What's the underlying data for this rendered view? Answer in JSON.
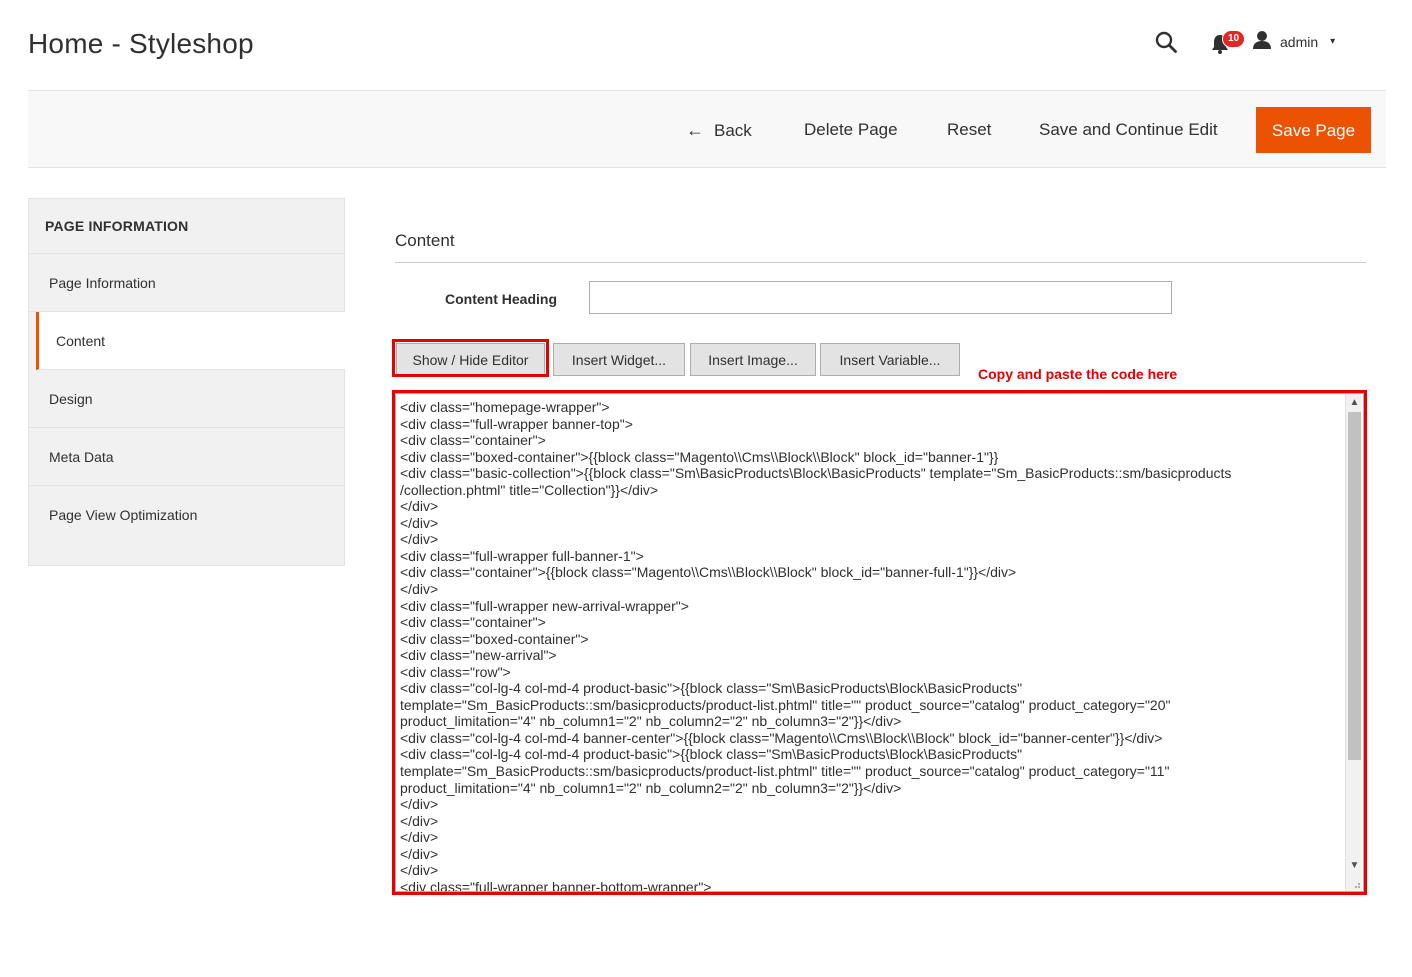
{
  "header": {
    "title": "Home - Styleshop",
    "notification_count": "10",
    "user_name": "admin",
    "user_caret": "▾",
    "icons": [
      "search-icon",
      "bell-icon",
      "user-icon"
    ]
  },
  "toolbar": {
    "back_label": "Back",
    "back_arrow": "←",
    "delete_label": "Delete Page",
    "reset_label": "Reset",
    "save_continue_label": "Save and Continue Edit",
    "save_label": "Save Page",
    "save_color": "#eb5202"
  },
  "sidebar": {
    "heading": "PAGE INFORMATION",
    "items": [
      {
        "label": "Page Information",
        "active": false
      },
      {
        "label": "Content",
        "active": true
      },
      {
        "label": "Design",
        "active": false
      },
      {
        "label": "Meta Data",
        "active": false
      },
      {
        "label": "Page View Optimization",
        "active": false
      }
    ]
  },
  "content": {
    "section_title": "Content",
    "heading_label": "Content Heading",
    "heading_value": "",
    "editor_buttons": {
      "toggle": "Show / Hide Editor",
      "widget": "Insert Widget...",
      "image": "Insert Image...",
      "variable": "Insert Variable..."
    },
    "annotation": "Copy and paste the code here",
    "highlight_color": "#e60000",
    "scroll_up": "▲",
    "scroll_down": "▼",
    "code_lines": [
      "<div class=\"homepage-wrapper\">",
      "<div class=\"full-wrapper banner-top\">",
      "<div class=\"container\">",
      "<div class=\"boxed-container\">{{block class=\"Magento\\\\Cms\\\\Block\\\\Block\" block_id=\"banner-1\"}}",
      "<div class=\"basic-collection\">{{block class=\"Sm\\BasicProducts\\Block\\BasicProducts\" template=\"Sm_BasicProducts::sm/basicproducts",
      "/collection.phtml\" title=\"Collection\"}}</div>",
      "</div>",
      "</div>",
      "</div>",
      "<div class=\"full-wrapper full-banner-1\">",
      "<div class=\"container\">{{block class=\"Magento\\\\Cms\\\\Block\\\\Block\" block_id=\"banner-full-1\"}}</div>",
      "</div>",
      "<div class=\"full-wrapper new-arrival-wrapper\">",
      "<div class=\"container\">",
      "<div class=\"boxed-container\">",
      "<div class=\"new-arrival\">",
      "<div class=\"row\">",
      "<div class=\"col-lg-4 col-md-4 product-basic\">{{block class=\"Sm\\BasicProducts\\Block\\BasicProducts\"",
      "template=\"Sm_BasicProducts::sm/basicproducts/product-list.phtml\" title=\"\" product_source=\"catalog\" product_category=\"20\"",
      "product_limitation=\"4\" nb_column1=\"2\" nb_column2=\"2\" nb_column3=\"2\"}}</div>",
      "<div class=\"col-lg-4 col-md-4 banner-center\">{{block class=\"Magento\\\\Cms\\\\Block\\\\Block\" block_id=\"banner-center\"}}</div>",
      "<div class=\"col-lg-4 col-md-4 product-basic\">{{block class=\"Sm\\BasicProducts\\Block\\BasicProducts\"",
      "template=\"Sm_BasicProducts::sm/basicproducts/product-list.phtml\" title=\"\" product_source=\"catalog\" product_category=\"11\"",
      "product_limitation=\"4\" nb_column1=\"2\" nb_column2=\"2\" nb_column3=\"2\"}}</div>",
      "</div>",
      "</div>",
      "</div>",
      "</div>",
      "</div>",
      "<div class=\"full-wrapper banner-bottom-wrapper\">"
    ]
  }
}
